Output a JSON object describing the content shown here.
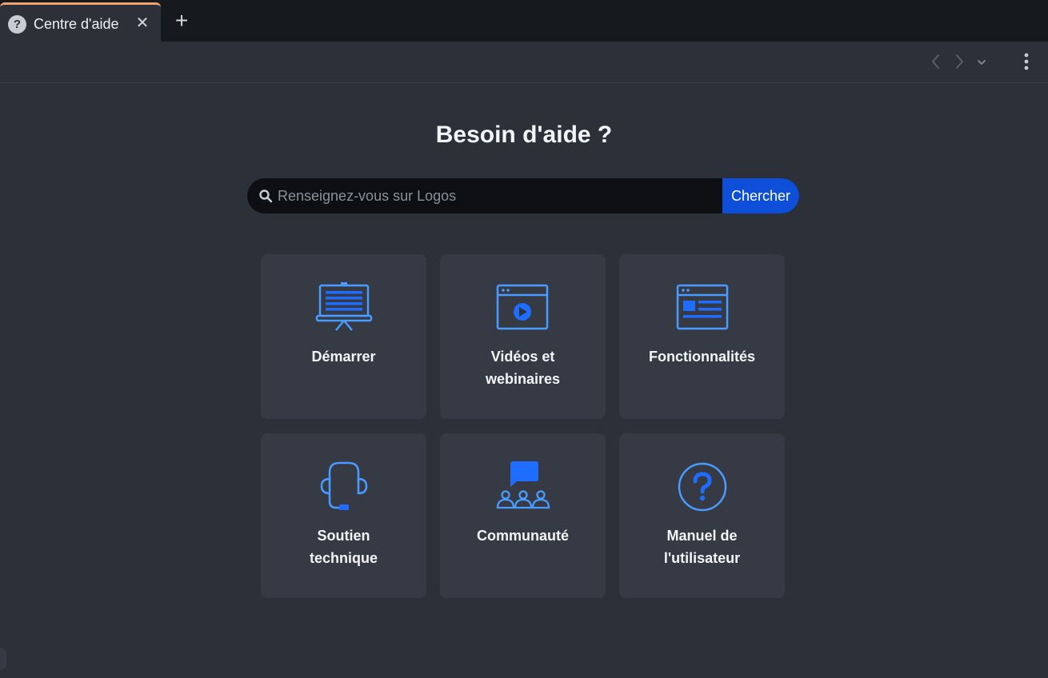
{
  "browser": {
    "tab": {
      "icon": "help-circle-icon",
      "title": "Centre d'aide",
      "close_glyph": "✕"
    },
    "new_tab_glyph": "+"
  },
  "toolbar": {
    "icons": [
      "chevron-left-icon",
      "chevron-right-icon",
      "chevron-down-icon",
      "kebab-menu-icon"
    ]
  },
  "page": {
    "heading": "Besoin d'aide ?",
    "search": {
      "placeholder": "Renseignez-vous sur Logos",
      "value": "",
      "button_label": "Chercher"
    },
    "cards": [
      {
        "icon": "presentation-board-icon",
        "label": "Démarrer"
      },
      {
        "icon": "video-player-icon",
        "label": "Vidéos et webinaires"
      },
      {
        "icon": "feature-window-icon",
        "label": "Fonctionnalités"
      },
      {
        "icon": "headset-icon",
        "label": "Soutien technique"
      },
      {
        "icon": "community-chat-icon",
        "label": "Communauté"
      },
      {
        "icon": "question-circle-icon",
        "label": "Manuel de l'utilisateur"
      }
    ]
  },
  "colors": {
    "background": "#2c3039",
    "tab_strip": "#16191e",
    "active_tab_accent": "#f0a36a",
    "card": "#353a45",
    "search_field": "#0d0f13",
    "primary_button": "#0d4fd8",
    "icon_outline": "#4a9bff",
    "icon_fill": "#1f6dff"
  }
}
